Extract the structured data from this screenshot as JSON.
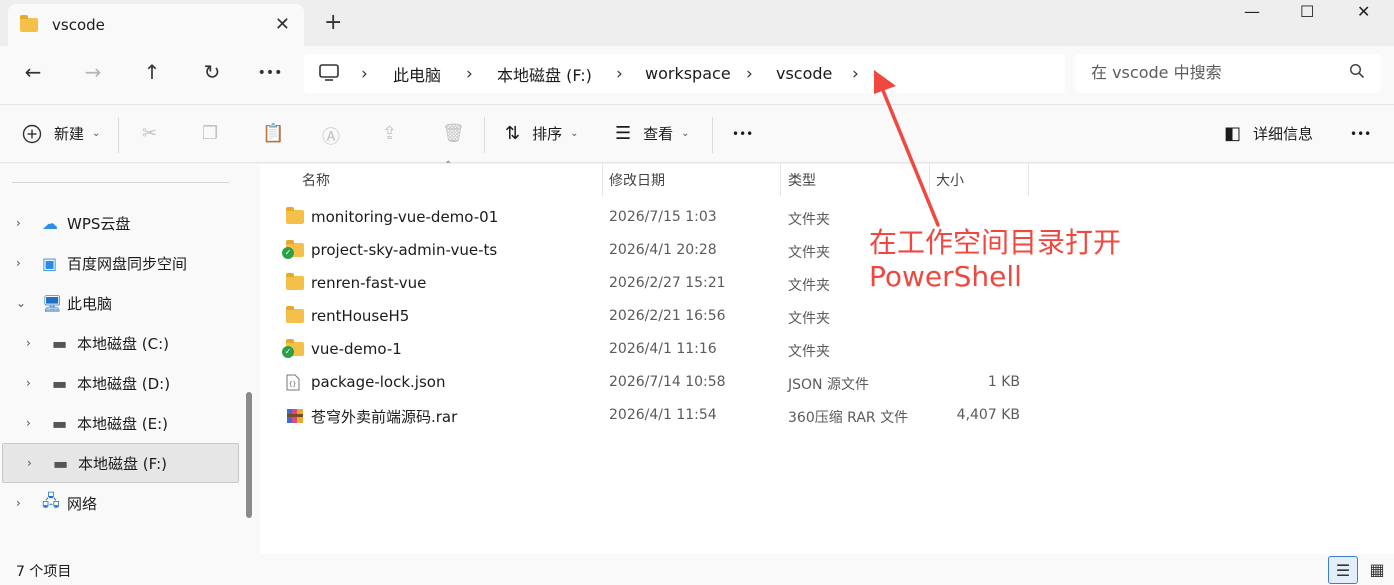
{
  "window": {
    "tab_title": "vscode",
    "tab_icon": "folder-icon",
    "close_tab_glyph": "✕",
    "new_tab_glyph": "+",
    "minimize_glyph": "—",
    "maximize_glyph": "☐",
    "close_glyph": "✕"
  },
  "nav": {
    "back_glyph": "←",
    "forward_glyph": "→",
    "up_glyph": "↑",
    "refresh_glyph": "↻",
    "more_glyph": "•••",
    "breadcrumb": [
      "此电脑",
      "本地磁盘 (F:)",
      "workspace",
      "vscode"
    ],
    "separator": "›",
    "search_placeholder": "在 vscode 中搜索"
  },
  "toolbar": {
    "new_label": "新建",
    "sort_label": "排序",
    "view_label": "查看",
    "more_glyph": "•••",
    "details_label": "详细信息"
  },
  "sidebar": {
    "items": [
      {
        "label": "WPS云盘",
        "icon": "cloud-icon"
      },
      {
        "label": "百度网盘同步空间",
        "icon": "baidu-netdisk-icon"
      },
      {
        "label": "此电脑",
        "icon": "computer-icon"
      },
      {
        "label": "本地磁盘 (C:)",
        "icon": "drive-icon"
      },
      {
        "label": "本地磁盘 (D:)",
        "icon": "drive-icon"
      },
      {
        "label": "本地磁盘 (E:)",
        "icon": "drive-icon"
      },
      {
        "label": "本地磁盘 (F:)",
        "icon": "drive-icon"
      },
      {
        "label": "网络",
        "icon": "network-icon"
      }
    ]
  },
  "columns": {
    "name": "名称",
    "date": "修改日期",
    "type": "类型",
    "size": "大小"
  },
  "files": [
    {
      "name": "monitoring-vue-demo-01",
      "date": "2026/7/15 1:03",
      "type": "文件夹",
      "size": "",
      "icon": "folder-icon"
    },
    {
      "name": "project-sky-admin-vue-ts",
      "date": "2026/4/1 20:28",
      "type": "文件夹",
      "size": "",
      "icon": "synced-folder-icon"
    },
    {
      "name": "renren-fast-vue",
      "date": "2026/2/27 15:21",
      "type": "文件夹",
      "size": "",
      "icon": "folder-icon"
    },
    {
      "name": "rentHouseH5",
      "date": "2026/2/21 16:56",
      "type": "文件夹",
      "size": "",
      "icon": "folder-icon"
    },
    {
      "name": "vue-demo-1",
      "date": "2026/4/1 11:16",
      "type": "文件夹",
      "size": "",
      "icon": "synced-folder-icon"
    },
    {
      "name": "package-lock.json",
      "date": "2026/7/14 10:58",
      "type": "JSON 源文件",
      "size": "1 KB",
      "icon": "json-file-icon"
    },
    {
      "name": "苍穹外卖前端源码.rar",
      "date": "2026/4/1 11:54",
      "type": "360压缩 RAR 文件",
      "size": "4,407 KB",
      "icon": "rar-archive-icon"
    }
  ],
  "annotation": {
    "line1": "在工作空间目录打开",
    "line2": "PowerShell",
    "color": "#f0473f"
  },
  "status": {
    "item_count": "7 个项目"
  }
}
